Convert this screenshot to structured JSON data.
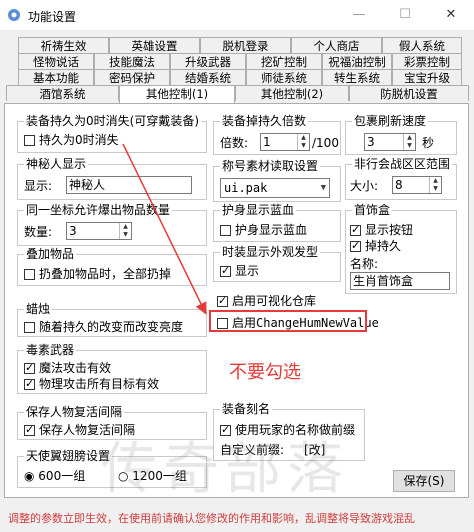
{
  "window": {
    "title": "功能设置",
    "minimize": "—",
    "maximize": "☐",
    "close": "✕"
  },
  "tabs": {
    "row1": [
      "祈祷生效",
      "英雄设置",
      "脱机登录",
      "个人商店",
      "假人系统"
    ],
    "row2": [
      "怪物说话",
      "技能魔法",
      "升级武器",
      "挖矿控制",
      "祝福油控制",
      "彩票控制"
    ],
    "row3": [
      "基本功能",
      "密码保护",
      "结婚系统",
      "师徒系统",
      "转生系统",
      "宝宝升级"
    ],
    "row4": [
      "酒馆系统",
      "其他控制(1)",
      "其他控制(2)",
      "防脱机设置"
    ]
  },
  "groups": {
    "durability": {
      "title": "装备持久为0时消失(可穿戴装备)",
      "checkbox": "持久为0时消失",
      "checked": false
    },
    "mysterious": {
      "title": "神秘人显示",
      "label": "显示:",
      "value": "神秘人"
    },
    "drop_count": {
      "title": "同一坐标允许爆出物品数量",
      "label": "数量:",
      "value": "3"
    },
    "stack": {
      "title": "叠加物品",
      "checkbox": "扔叠加物品时，全部扔掉",
      "checked": false
    },
    "candle": {
      "title": "蜡烛",
      "checkbox": "随着持久的改变而改变亮度",
      "checked": false
    },
    "poison": {
      "title": "毒素武器",
      "items": [
        {
          "label": "魔法攻击有效",
          "checked": true
        },
        {
          "label": "物理攻击所有目标有效",
          "checked": true
        }
      ]
    },
    "revive": {
      "title": "保存人物复活间隔",
      "checkbox": "保存人物复活间隔",
      "checked": true
    },
    "wings": {
      "title": "天使翼翅膀设置",
      "options": [
        "600一组",
        "1200一组"
      ],
      "selected": "600一组"
    },
    "drop_ratio": {
      "title": "装备掉持久倍数",
      "label": "倍数:",
      "value": "1",
      "suffix": "/100"
    },
    "refresh": {
      "title": "包裹刷新速度",
      "value": "3",
      "unit": "秒"
    },
    "title_read": {
      "title": "称号素材读取设置",
      "value": "ui.pak"
    },
    "guild_zone": {
      "title": "非行会战区区范围",
      "label": "大小:",
      "value": "8"
    },
    "protect": {
      "title": "护身显示蓝血",
      "checkbox": "护身显示蓝血",
      "checked": false
    },
    "fashion": {
      "title": "时装显示外观发型",
      "checkbox": "显示",
      "checked": true
    },
    "visual_store": {
      "checkbox": "启用可视化仓库",
      "checked": true
    },
    "change_hum": {
      "checkbox": "启用ChangeHumNewValue",
      "checked": false
    },
    "jewelry": {
      "title": "首饰盒",
      "items": [
        {
          "label": "显示按钮",
          "checked": true
        },
        {
          "label": "掉持久",
          "checked": true
        }
      ],
      "name_label": "名称:",
      "name_value": "生肖首饰盒"
    },
    "engrave": {
      "title": "装备刻名",
      "checkbox": "使用玩家的名称做前缀",
      "checked": true,
      "custom_label": "自定义前缀:",
      "custom_value": "[改]"
    }
  },
  "save_button": "保存(S)",
  "annotation": "不要勾选",
  "footer": "调整的参数立即生效，在使用前请确认您修改的作用和影响，乱调整将导致游戏混乱",
  "watermark": "传奇部落",
  "colors": {
    "annotation": "#e63b3b",
    "panel": "#ffffff",
    "background": "#f0f0f0"
  }
}
